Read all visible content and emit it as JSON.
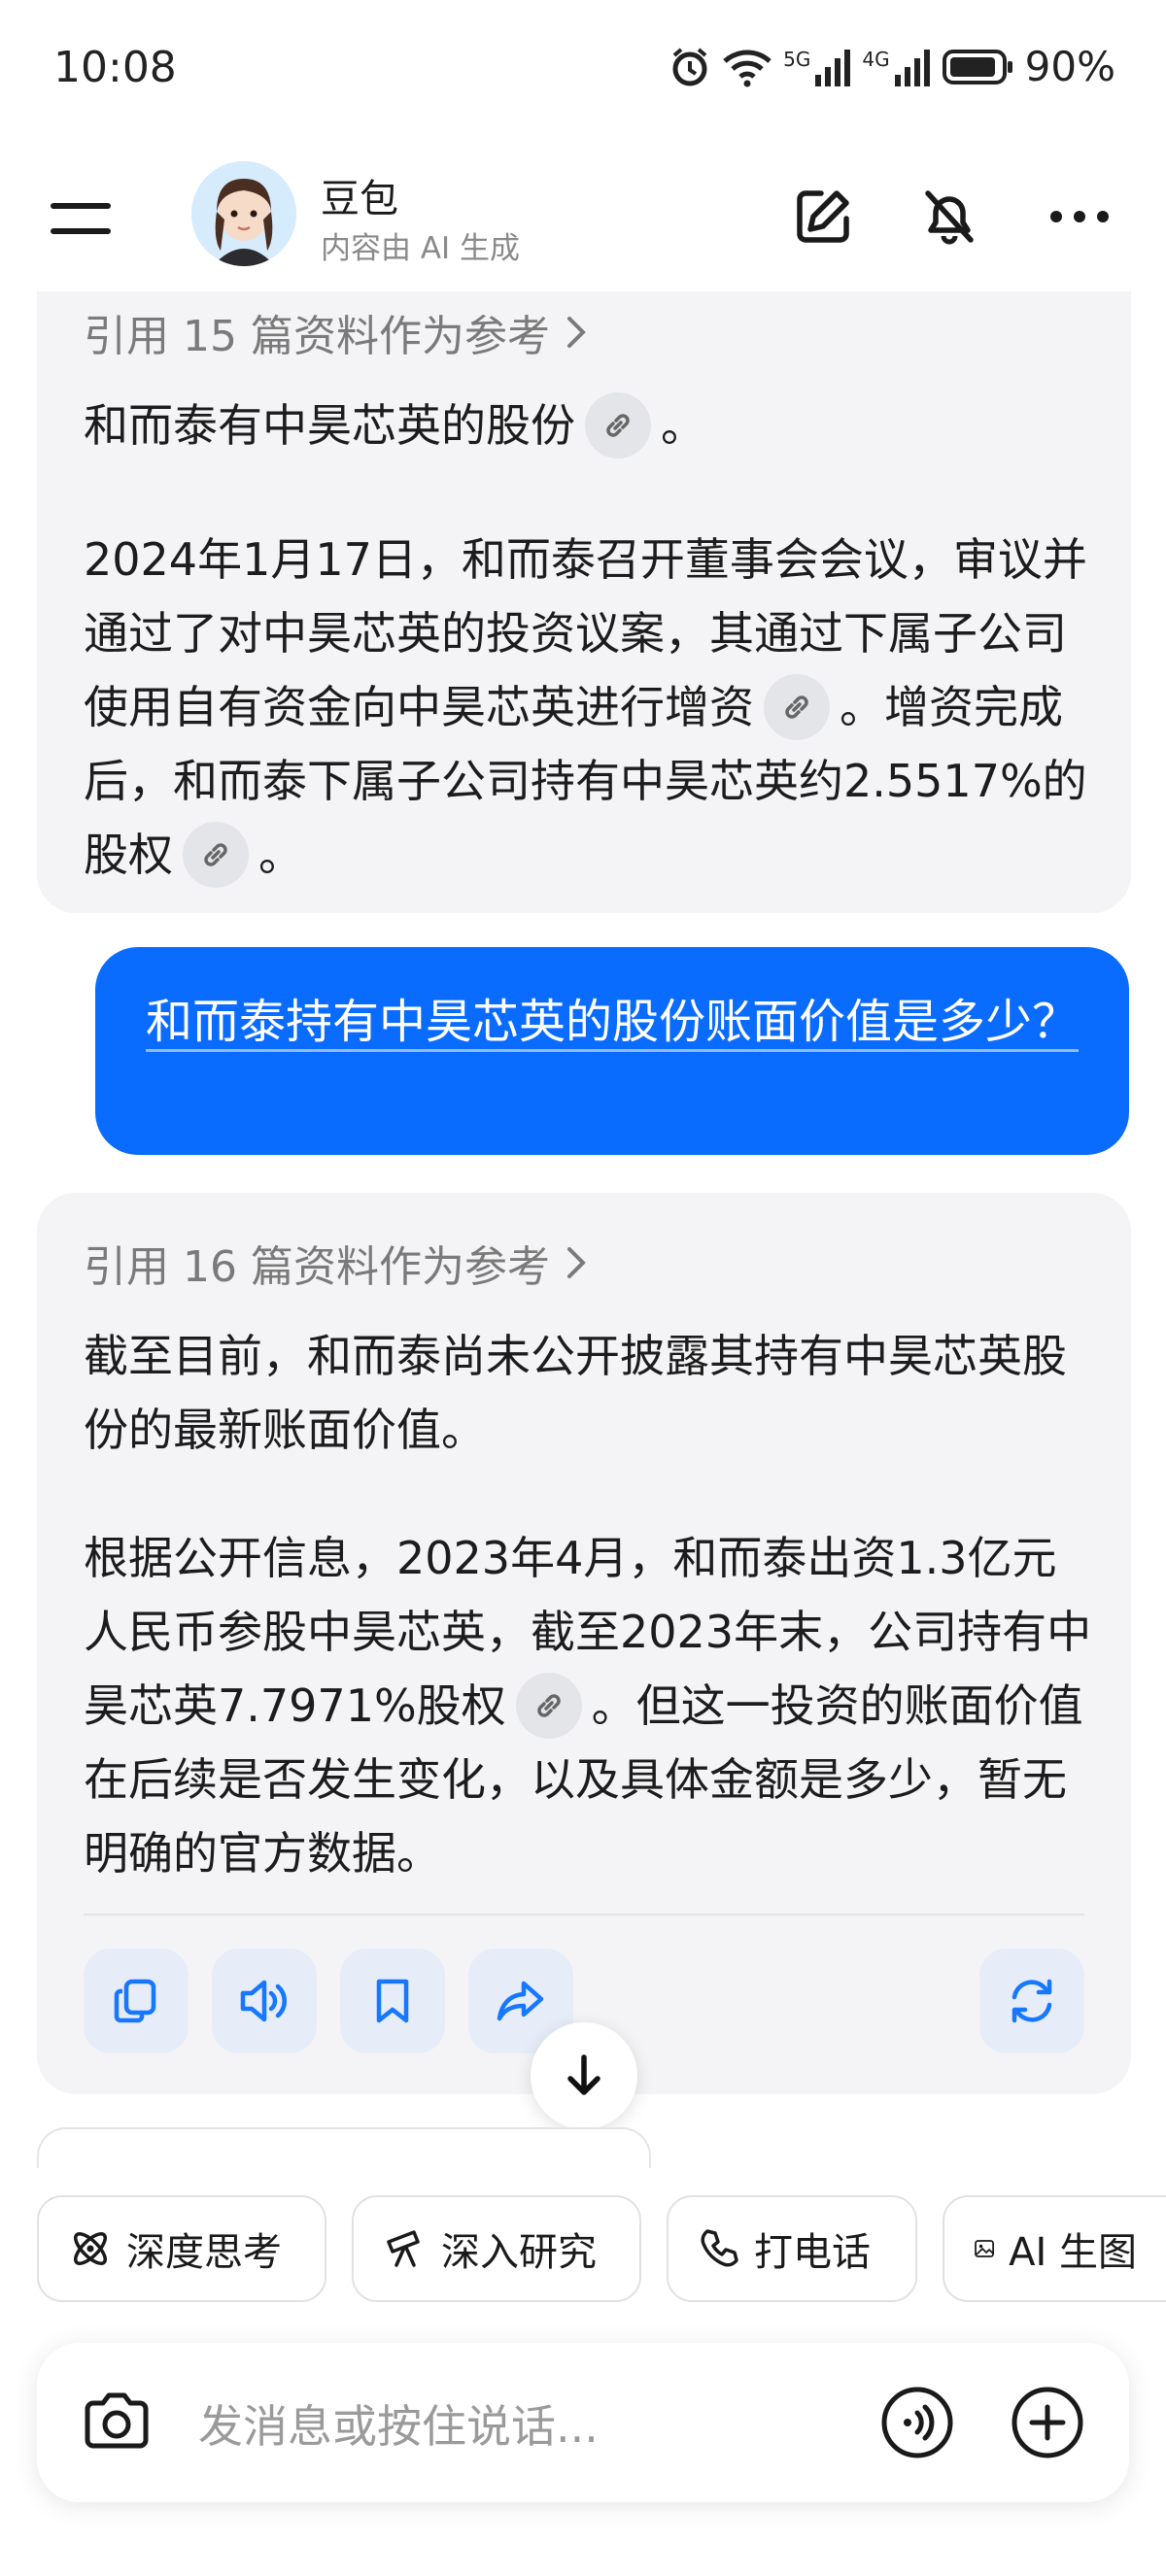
{
  "status_bar": {
    "time": "10:08",
    "signal_5g": "5G",
    "signal_4g": "4G",
    "battery": "90%"
  },
  "header": {
    "bot_name": "豆包",
    "subtitle": "内容由 AI 生成",
    "icons": [
      "menu-icon",
      "avatar",
      "edit-icon",
      "mute-icon",
      "more-icon"
    ]
  },
  "messages": {
    "ai1": {
      "ref_label": "引用 15 篇资料作为参考",
      "p1": "和而泰有中昊芯英的股份",
      "p1_end": "。",
      "p2a": "2024年1月17日，和而泰召开董事会会议，审议并通过了对中昊芯英的投资议案，其通过下属子公司使用自有资金向中昊芯英进行增资",
      "p2b": "。增资完成后，和而泰下属子公司持有中昊芯英约2.5517%的股权",
      "p2_end": "。"
    },
    "user1": {
      "text": "和而泰持有中昊芯英的股份账面价值是多少？"
    },
    "ai2": {
      "ref_label": "引用 16 篇资料作为参考",
      "p1": "截至目前，和而泰尚未公开披露其持有中昊芯英股份的最新账面价值。",
      "p2a": "根据公开信息，2023年4月，和而泰出资1.3亿元人民币参股中昊芯英，截至2023年末，公司持有中昊芯英7.7971%股权",
      "p2b": "。但这一投资的账面价值在后续是否发生变化，以及具体金额是多少，暂无明确的官方数据。",
      "actions": [
        "copy-icon",
        "speaker-icon",
        "bookmark-icon",
        "share-icon",
        "refresh-icon"
      ]
    }
  },
  "chips": [
    {
      "label": "深度思考",
      "icon": "atom-icon"
    },
    {
      "label": "深入研究",
      "icon": "telescope-icon"
    },
    {
      "label": "打电话",
      "icon": "phone-icon"
    },
    {
      "label": "AI 生图",
      "icon": "image-icon"
    }
  ],
  "input": {
    "placeholder": "发消息或按住说话..."
  },
  "colors": {
    "user_bubble": "#0a6cff",
    "ai_bubble": "#f4f4f6",
    "accent": "#1677ff"
  }
}
